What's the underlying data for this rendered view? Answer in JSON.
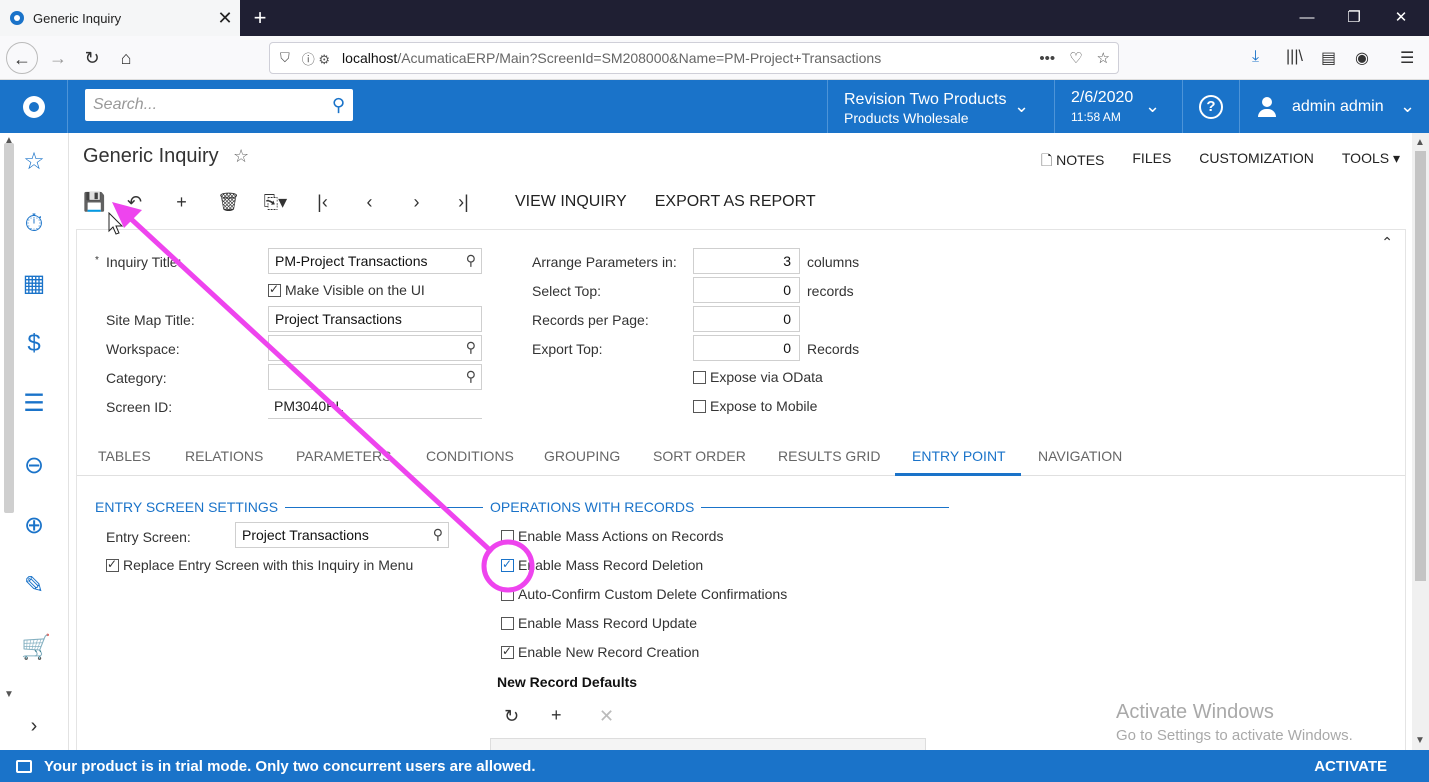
{
  "browser": {
    "tab_title": "Generic Inquiry",
    "tab_close": "✕",
    "new_tab": "+",
    "url_host": "localhost",
    "url_path": "/AcumaticaERP/Main?ScreenId=SM208000&Name=PM-Project+Transactions",
    "url_more": "•••"
  },
  "header": {
    "search_placeholder": "Search...",
    "company_name": "Revision Two Products",
    "company_branch": "Products Wholesale",
    "date": "2/6/2020",
    "time": "11:58 AM",
    "help_label": "?",
    "user_name": "admin admin"
  },
  "page": {
    "title": "Generic Inquiry",
    "links": {
      "notes": "NOTES",
      "files": "FILES",
      "customization": "CUSTOMIZATION",
      "tools": "TOOLS ▾"
    },
    "toolbar": {
      "view_inquiry": "VIEW INQUIRY",
      "export_as_report": "EXPORT AS REPORT"
    }
  },
  "form": {
    "inquiry_title_label": "Inquiry Title:",
    "required_mark": "*",
    "inquiry_title_value": "PM-Project Transactions",
    "make_visible_label": "Make Visible on the UI",
    "site_map_title_label": "Site Map Title:",
    "site_map_title_value": "Project Transactions",
    "workspace_label": "Workspace:",
    "workspace_value": "",
    "category_label": "Category:",
    "category_value": "",
    "screen_id_label": "Screen ID:",
    "screen_id_value": "PM3040PL",
    "arrange_label": "Arrange Parameters in:",
    "arrange_value": "3",
    "arrange_unit": "columns",
    "select_top_label": "Select Top:",
    "select_top_value": "0",
    "select_top_unit": "records",
    "records_per_page_label": "Records per Page:",
    "records_per_page_value": "0",
    "export_top_label": "Export Top:",
    "export_top_value": "0",
    "export_top_unit": "Records",
    "expose_odata_label": "Expose via OData",
    "expose_mobile_label": "Expose to Mobile"
  },
  "tabs": [
    "TABLES",
    "RELATIONS",
    "PARAMETERS",
    "CONDITIONS",
    "GROUPING",
    "SORT ORDER",
    "RESULTS GRID",
    "ENTRY POINT",
    "NAVIGATION"
  ],
  "entry_point": {
    "entry_screen_settings": "ENTRY SCREEN SETTINGS",
    "entry_screen_label": "Entry Screen:",
    "entry_screen_value": "Project Transactions",
    "replace_entry_label": "Replace Entry Screen with this Inquiry in Menu",
    "operations_with_records": "OPERATIONS WITH RECORDS",
    "mass_actions_label": "Enable Mass Actions on Records",
    "mass_deletion_label": "Enable Mass Record Deletion",
    "auto_confirm_label": "Auto-Confirm Custom Delete Confirmations",
    "mass_update_label": "Enable Mass Record Update",
    "new_record_label": "Enable New Record Creation",
    "new_record_defaults": "New Record Defaults"
  },
  "watermark": {
    "line1": "Activate Windows",
    "line2": "Go to Settings to activate Windows."
  },
  "status": {
    "message": "Your product is in trial mode. Only two concurrent users are allowed.",
    "activate": "ACTIVATE"
  },
  "colors": {
    "brand": "#1a73c9",
    "annotation": "#ee44ee"
  }
}
